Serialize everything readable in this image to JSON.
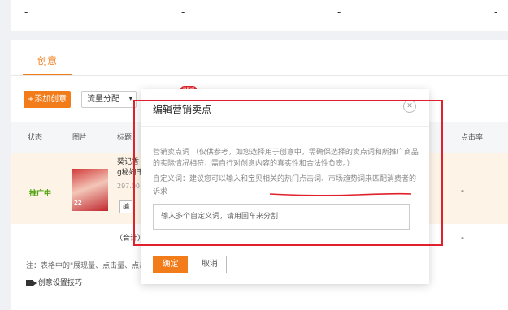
{
  "top": {
    "dashes": [
      "-",
      "-",
      "-",
      "-"
    ]
  },
  "tabs": {
    "active": "创意"
  },
  "toolbar": {
    "add_label": "+添加创意",
    "flow_select": "流量分配",
    "new_badge": "NEW"
  },
  "table": {
    "headers": [
      "状态",
      "图片",
      "标题",
      "点击率"
    ],
    "row": {
      "status": "推广中",
      "thumb_text": "22",
      "title_lines": [
        "葵记香",
        "g秘妇千"
      ],
      "number": "297.00",
      "edit_mark": "编",
      "click_rate": "-"
    },
    "total_label": "（合计）",
    "total_value": "-"
  },
  "footnote": "注：表格中的\"展现量、点击量、点击",
  "tips": "创意设置技巧",
  "dialog": {
    "title": "编辑营销卖点",
    "close": "✕",
    "desc": "营销卖点词 （仅供参考，如您选择用于创意中，需确保选择的卖点词和所推广商品的实际情况相符，需自行对创意内容的真实性和合法性负责。）",
    "hint": "自定义词：建议您可以输入和宝贝相关的热门点击词、市场趋势词来匹配消费者的诉求",
    "input_placeholder": "输入多个自定义词，请用回车来分割",
    "ok": "确定",
    "cancel": "取消"
  },
  "colors": {
    "accent": "#f27c1a",
    "annotation": "#e0212b",
    "active_status": "#4fa30f"
  }
}
